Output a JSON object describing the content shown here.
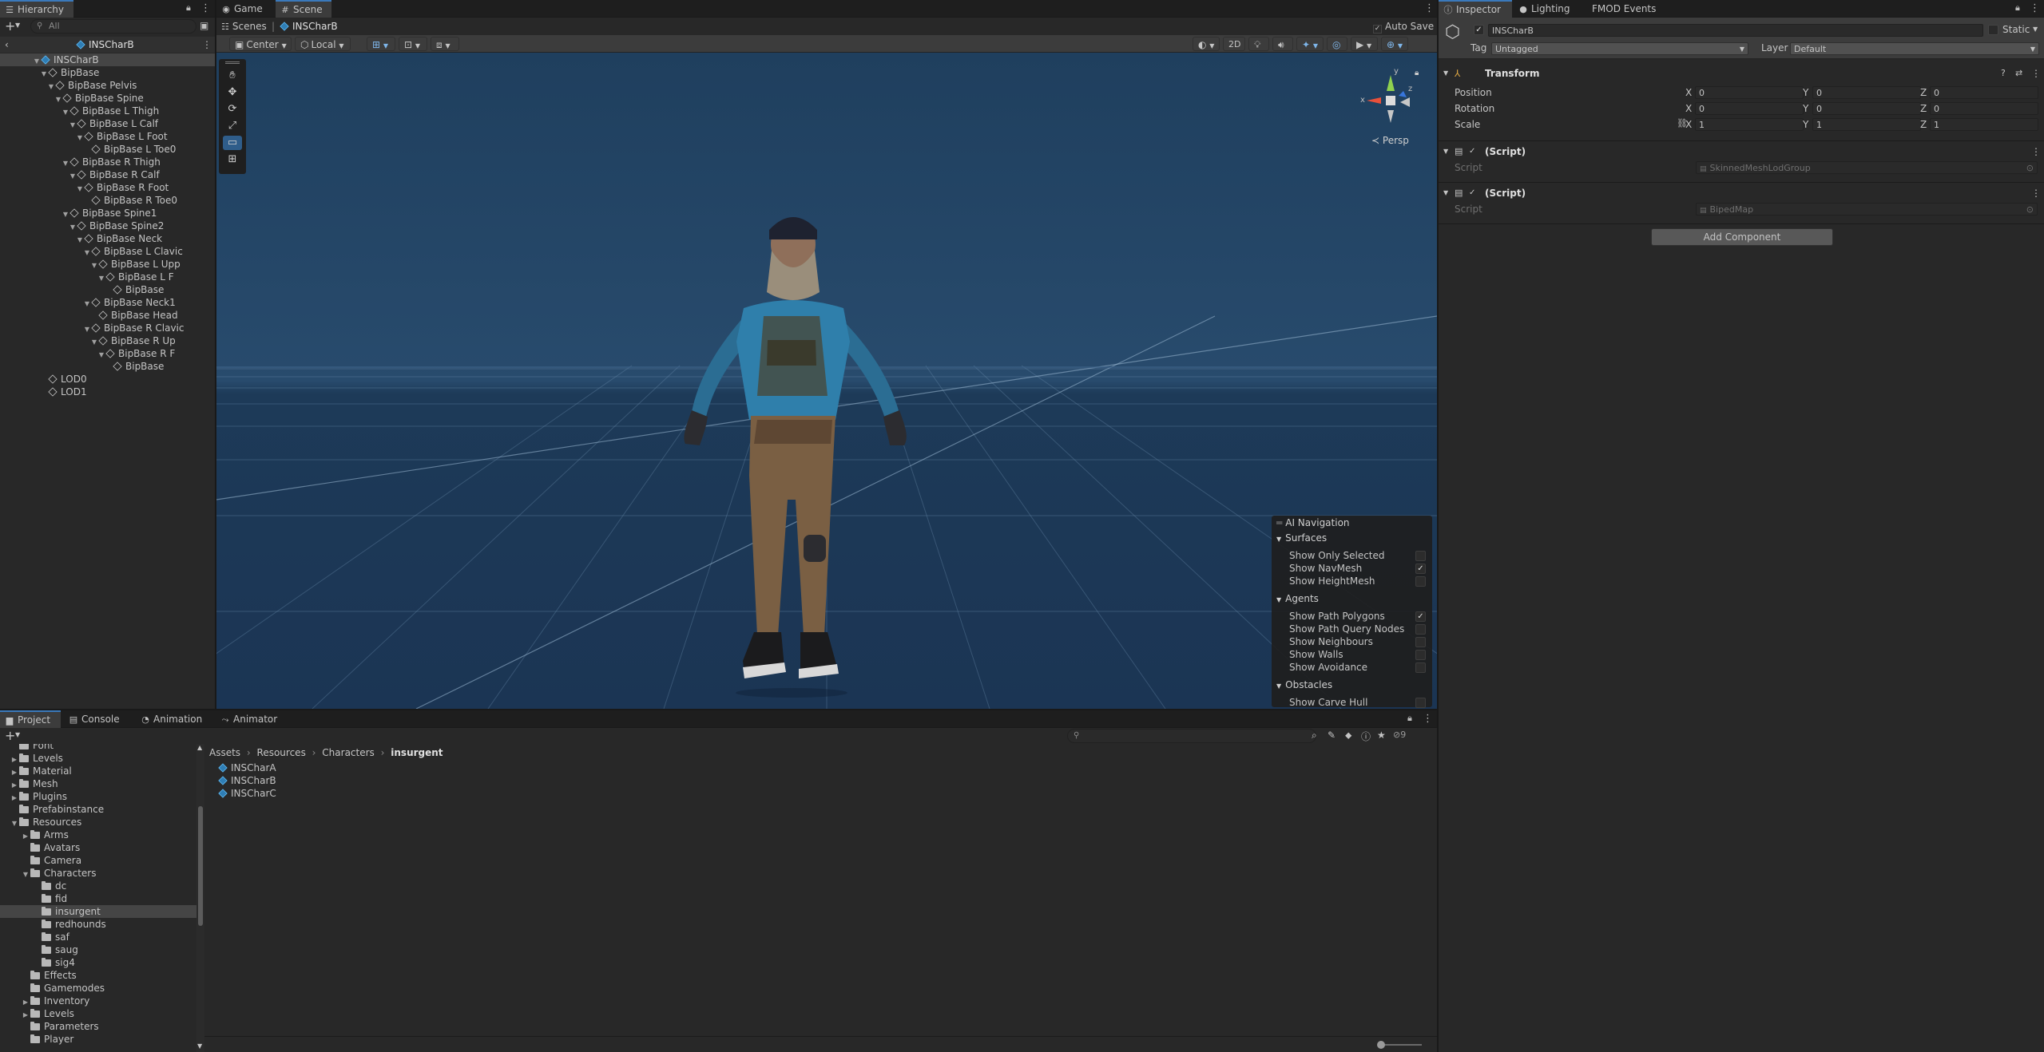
{
  "hierarchy": {
    "tab": "Hierarchy",
    "search_placeholder": "All",
    "scene_name": "INSCharB",
    "items": [
      {
        "label": "INSCharB",
        "depth": 0,
        "arrow": "open",
        "selected": true
      },
      {
        "label": "BipBase",
        "depth": 1,
        "arrow": "open"
      },
      {
        "label": "BipBase Pelvis",
        "depth": 2,
        "arrow": "open"
      },
      {
        "label": "BipBase Spine",
        "depth": 3,
        "arrow": "open"
      },
      {
        "label": "BipBase L Thigh",
        "depth": 4,
        "arrow": "open"
      },
      {
        "label": "BipBase L Calf",
        "depth": 5,
        "arrow": "open"
      },
      {
        "label": "BipBase L Foot",
        "depth": 6,
        "arrow": "open"
      },
      {
        "label": "BipBase L Toe0",
        "depth": 7,
        "arrow": "none"
      },
      {
        "label": "BipBase R Thigh",
        "depth": 4,
        "arrow": "open"
      },
      {
        "label": "BipBase R Calf",
        "depth": 5,
        "arrow": "open"
      },
      {
        "label": "BipBase R Foot",
        "depth": 6,
        "arrow": "open"
      },
      {
        "label": "BipBase R Toe0",
        "depth": 7,
        "arrow": "none"
      },
      {
        "label": "BipBase Spine1",
        "depth": 4,
        "arrow": "open"
      },
      {
        "label": "BipBase Spine2",
        "depth": 5,
        "arrow": "open"
      },
      {
        "label": "BipBase Neck",
        "depth": 6,
        "arrow": "open"
      },
      {
        "label": "BipBase L Clavic",
        "depth": 7,
        "arrow": "open"
      },
      {
        "label": "BipBase L Upp",
        "depth": 8,
        "arrow": "open"
      },
      {
        "label": "BipBase L F",
        "depth": 9,
        "arrow": "open"
      },
      {
        "label": "BipBase",
        "depth": 10,
        "arrow": "none"
      },
      {
        "label": "BipBase Neck1",
        "depth": 7,
        "arrow": "open"
      },
      {
        "label": "BipBase Head",
        "depth": 8,
        "arrow": "none"
      },
      {
        "label": "BipBase R Clavic",
        "depth": 7,
        "arrow": "open"
      },
      {
        "label": "BipBase R Up",
        "depth": 8,
        "arrow": "open"
      },
      {
        "label": "BipBase R F",
        "depth": 9,
        "arrow": "open"
      },
      {
        "label": "BipBase",
        "depth": 10,
        "arrow": "none"
      },
      {
        "label": "LOD0",
        "depth": 1,
        "arrow": "none"
      },
      {
        "label": "LOD1",
        "depth": 1,
        "arrow": "none"
      }
    ]
  },
  "scene_view": {
    "tabs": [
      {
        "label": "Game",
        "icon": "gamepad-icon"
      },
      {
        "label": "Scene",
        "icon": "grid-icon"
      }
    ],
    "breadcrumb": {
      "root": "Scenes",
      "current": "INSCharB"
    },
    "auto_save_label": "Auto Save",
    "pivot_mode": "Center",
    "pivot_space": "Local",
    "mode_2d": "2D",
    "persp_label": "Persp",
    "gizmo_axes": {
      "x": "x",
      "y": "y",
      "z": "z"
    }
  },
  "ai_navigation": {
    "title": "AI Navigation",
    "sections": [
      {
        "name": "Surfaces",
        "items": [
          {
            "label": "Show Only Selected",
            "checked": false
          },
          {
            "label": "Show NavMesh",
            "checked": true
          },
          {
            "label": "Show HeightMesh",
            "checked": false
          }
        ]
      },
      {
        "name": "Agents",
        "items": [
          {
            "label": "Show Path Polygons",
            "checked": true
          },
          {
            "label": "Show Path Query Nodes",
            "checked": false
          },
          {
            "label": "Show Neighbours",
            "checked": false
          },
          {
            "label": "Show Walls",
            "checked": false
          },
          {
            "label": "Show Avoidance",
            "checked": false
          }
        ]
      },
      {
        "name": "Obstacles",
        "items": [
          {
            "label": "Show Carve Hull",
            "checked": false
          }
        ]
      }
    ]
  },
  "inspector": {
    "tabs": [
      {
        "label": "Inspector",
        "icon": "info-icon"
      },
      {
        "label": "Lighting",
        "icon": "bulb-icon"
      },
      {
        "label": "FMOD Events",
        "icon": ""
      }
    ],
    "object_name": "INSCharB",
    "static_label": "Static",
    "tag_label": "Tag",
    "tag_value": "Untagged",
    "layer_label": "Layer",
    "layer_value": "Default",
    "transform": {
      "title": "Transform",
      "rows": [
        {
          "label": "Position",
          "x": "0",
          "y": "0",
          "z": "0"
        },
        {
          "label": "Rotation",
          "x": "0",
          "y": "0",
          "z": "0"
        },
        {
          "label": "Scale",
          "x": "1",
          "y": "1",
          "z": "1"
        }
      ],
      "axis": {
        "x": "X",
        "y": "Y",
        "z": "Z"
      }
    },
    "components": [
      {
        "title": "(Script)",
        "script_label": "Script",
        "script_value": "SkinnedMeshLodGroup"
      },
      {
        "title": "(Script)",
        "script_label": "Script",
        "script_value": "BipedMap"
      }
    ],
    "add_component": "Add Component"
  },
  "project": {
    "tabs": [
      {
        "label": "Project",
        "icon": "folder-icon"
      },
      {
        "label": "Console",
        "icon": "console-icon"
      },
      {
        "label": "Animation",
        "icon": "animation-icon"
      },
      {
        "label": "Animator",
        "icon": "animator-icon"
      }
    ],
    "hidden_count": "9",
    "tree": [
      {
        "label": "Font",
        "depth": 1,
        "arrow": "none"
      },
      {
        "label": "Levels",
        "depth": 1,
        "arrow": "closed"
      },
      {
        "label": "Material",
        "depth": 1,
        "arrow": "closed"
      },
      {
        "label": "Mesh",
        "depth": 1,
        "arrow": "closed"
      },
      {
        "label": "Plugins",
        "depth": 1,
        "arrow": "closed"
      },
      {
        "label": "Prefabinstance",
        "depth": 1,
        "arrow": "none"
      },
      {
        "label": "Resources",
        "depth": 1,
        "arrow": "open"
      },
      {
        "label": "Arms",
        "depth": 2,
        "arrow": "closed"
      },
      {
        "label": "Avatars",
        "depth": 2,
        "arrow": "none"
      },
      {
        "label": "Camera",
        "depth": 2,
        "arrow": "none"
      },
      {
        "label": "Characters",
        "depth": 2,
        "arrow": "open"
      },
      {
        "label": "dc",
        "depth": 3,
        "arrow": "none"
      },
      {
        "label": "fid",
        "depth": 3,
        "arrow": "none"
      },
      {
        "label": "insurgent",
        "depth": 3,
        "arrow": "none",
        "selected": true
      },
      {
        "label": "redhounds",
        "depth": 3,
        "arrow": "none"
      },
      {
        "label": "saf",
        "depth": 3,
        "arrow": "none"
      },
      {
        "label": "saug",
        "depth": 3,
        "arrow": "none"
      },
      {
        "label": "sig4",
        "depth": 3,
        "arrow": "none"
      },
      {
        "label": "Effects",
        "depth": 2,
        "arrow": "none"
      },
      {
        "label": "Gamemodes",
        "depth": 2,
        "arrow": "none"
      },
      {
        "label": "Inventory",
        "depth": 2,
        "arrow": "closed"
      },
      {
        "label": "Levels",
        "depth": 2,
        "arrow": "closed"
      },
      {
        "label": "Parameters",
        "depth": 2,
        "arrow": "none"
      },
      {
        "label": "Player",
        "depth": 2,
        "arrow": "none"
      }
    ],
    "breadcrumb": [
      "Assets",
      "Resources",
      "Characters",
      "insurgent"
    ],
    "files": [
      "INSCharA",
      "INSCharB",
      "INSCharC"
    ]
  },
  "colors": {
    "accent": "#3a79bb",
    "selection": "#454545",
    "prefab": "#5fb8f0"
  }
}
